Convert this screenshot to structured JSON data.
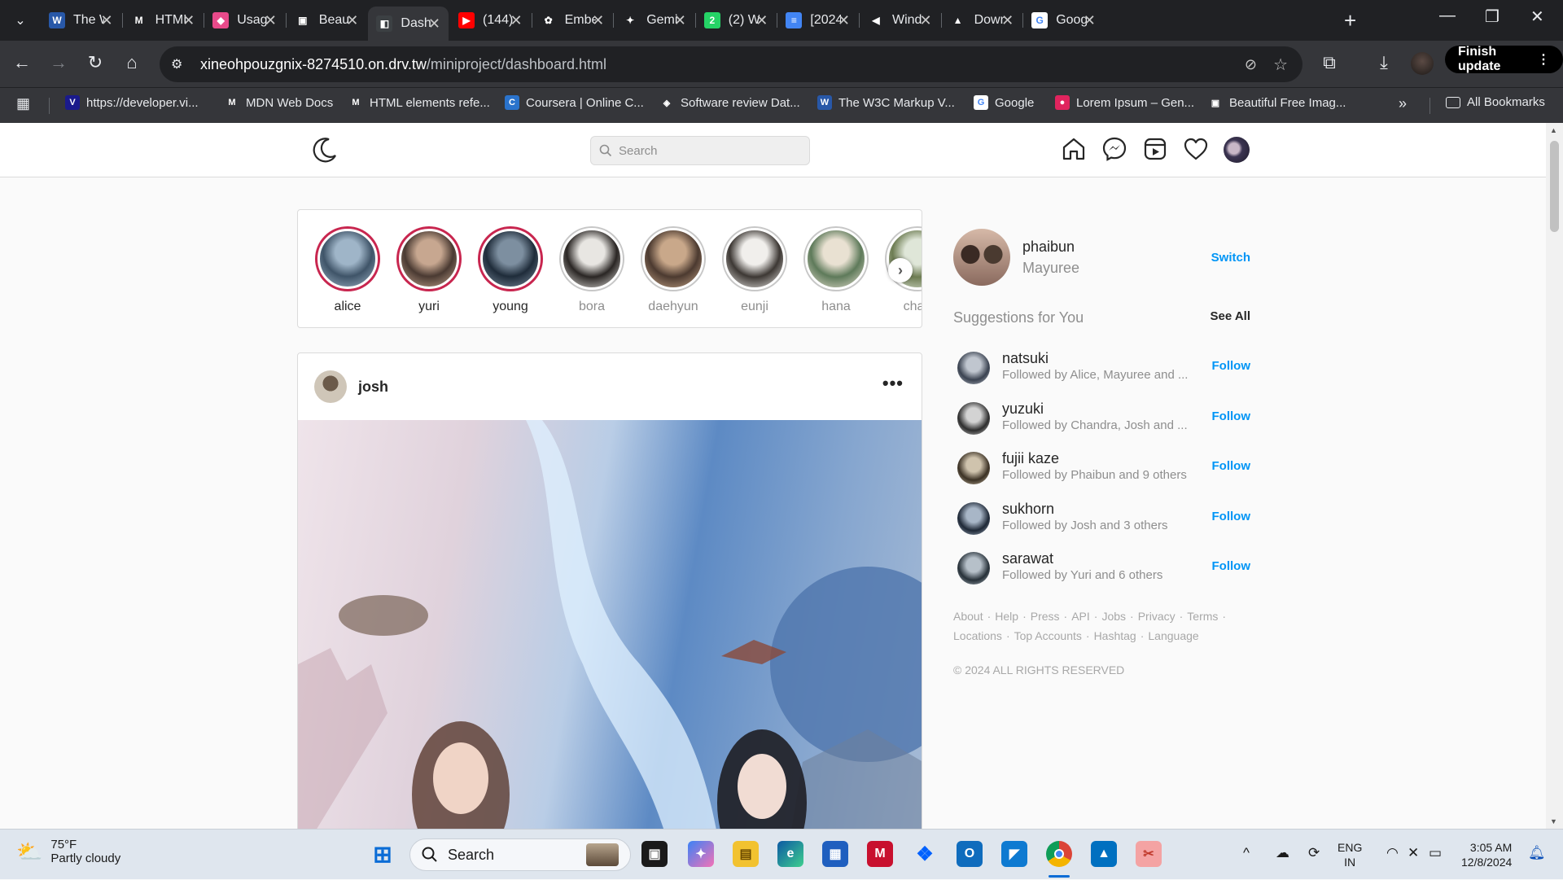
{
  "browser": {
    "tabs": [
      {
        "title": "The W",
        "icon": "w3c-icon",
        "color": "#2858a8",
        "glyph": "W"
      },
      {
        "title": "HTML",
        "icon": "mdn-icon",
        "color": "#202124",
        "glyph": "M"
      },
      {
        "title": "Usag",
        "icon": "cube-icon",
        "color": "#e84a8a",
        "glyph": "◆"
      },
      {
        "title": "Beau",
        "icon": "camera-icon",
        "color": "#202124",
        "glyph": "▣"
      },
      {
        "title": "Dash",
        "icon": "page-icon",
        "color": "#3c4043",
        "glyph": "◧"
      },
      {
        "title": "(144)",
        "icon": "youtube-icon",
        "color": "#ff0000",
        "glyph": "▶"
      },
      {
        "title": "Embe",
        "icon": "openai-icon",
        "color": "#202124",
        "glyph": "✿"
      },
      {
        "title": "Gemi",
        "icon": "gemini-icon",
        "color": "#202124",
        "glyph": "✦"
      },
      {
        "title": "(2) W",
        "icon": "whatsapp-icon",
        "color": "#25d366",
        "glyph": "2"
      },
      {
        "title": "[2024",
        "icon": "docs-icon",
        "color": "#4285f4",
        "glyph": "≡"
      },
      {
        "title": "Wind",
        "icon": "flutter-icon",
        "color": "#202124",
        "glyph": "◀"
      },
      {
        "title": "Down",
        "icon": "android-icon",
        "color": "#202124",
        "glyph": "▲"
      },
      {
        "title": "Goog",
        "icon": "google-icon",
        "color": "#ffffff",
        "glyph": "G"
      }
    ],
    "url_host": "xineohpouzgnix-8274510.on.drv.tw",
    "url_path": "/miniproject/dashboard.html",
    "finish_update": "Finish update",
    "bookmarks": [
      {
        "label": "https://developer.vi...",
        "icon": "vimeo-icon",
        "color": "#1a1a8c",
        "glyph": "V"
      },
      {
        "label": "MDN Web Docs",
        "icon": "mdn-icon",
        "color": "#35363a",
        "glyph": "M"
      },
      {
        "label": "HTML elements refe...",
        "icon": "mdn-icon",
        "color": "#35363a",
        "glyph": "M"
      },
      {
        "label": "Coursera | Online C...",
        "icon": "coursera-icon",
        "color": "#2a73cc",
        "glyph": "C"
      },
      {
        "label": "Software review Dat...",
        "icon": "g2-icon",
        "color": "#35363a",
        "glyph": "◈"
      },
      {
        "label": "The W3C Markup V...",
        "icon": "w3c-icon",
        "color": "#2858a8",
        "glyph": "W"
      },
      {
        "label": "Google",
        "icon": "google-icon",
        "color": "#ffffff",
        "glyph": "G"
      },
      {
        "label": "Lorem Ipsum – Gen...",
        "icon": "lorem-icon",
        "color": "#e0245e",
        "glyph": "●"
      },
      {
        "label": "Beautiful Free Imag...",
        "icon": "unsplash-icon",
        "color": "#35363a",
        "glyph": "▣"
      }
    ],
    "all_bookmarks": "All Bookmarks"
  },
  "app": {
    "search_placeholder": "Search",
    "stories": [
      {
        "name": "alice",
        "seen": false,
        "c1": "#9fb5c8",
        "c2": "#3f5468"
      },
      {
        "name": "yuri",
        "seen": false,
        "c1": "#c7a790",
        "c2": "#4a3a32"
      },
      {
        "name": "young",
        "seen": false,
        "c1": "#7d8fa0",
        "c2": "#1f2c3a"
      },
      {
        "name": "bora",
        "seen": true,
        "c1": "#e8e6e2",
        "c2": "#2a2624"
      },
      {
        "name": "daehyun",
        "seen": true,
        "c1": "#c9a88a",
        "c2": "#4c3a30"
      },
      {
        "name": "eunji",
        "seen": true,
        "c1": "#f1efec",
        "c2": "#3d3834"
      },
      {
        "name": "hana",
        "seen": true,
        "c1": "#e9e1d2",
        "c2": "#5e7a5a"
      },
      {
        "name": "chan",
        "seen": true,
        "c1": "#dfe6d8",
        "c2": "#6d7c52"
      }
    ],
    "post": {
      "user": "josh",
      "more": "•••"
    },
    "me": {
      "username": "phaibun",
      "name": "Mayuree",
      "switch": "Switch"
    },
    "suggestions_heading": "Suggestions for You",
    "see_all": "See All",
    "suggestions": [
      {
        "user": "natsuki",
        "followed": "Followed by Alice, Mayuree and ...",
        "follow": "Follow",
        "c1": "#c0c6cf",
        "c2": "#3a4250"
      },
      {
        "user": "yuzuki",
        "followed": "Followed by Chandra, Josh and ...",
        "follow": "Follow",
        "c1": "#d3d3d3",
        "c2": "#2d2d2d"
      },
      {
        "user": "fujii kaze",
        "followed": "Followed by Phaibun and 9 others",
        "follow": "Follow",
        "c1": "#cfc3ad",
        "c2": "#3b3124"
      },
      {
        "user": "sukhorn",
        "followed": "Followed by Josh and 3 others",
        "follow": "Follow",
        "c1": "#a8b6c7",
        "c2": "#1e2836"
      },
      {
        "user": "sarawat",
        "followed": "Followed by Yuri and 6 others",
        "follow": "Follow",
        "c1": "#b6c0c9",
        "c2": "#263038"
      }
    ],
    "footer_links_row1": [
      "About",
      "Help",
      "Press",
      "API",
      "Jobs",
      "Privacy",
      "Terms"
    ],
    "footer_links_row2": [
      "Locations",
      "Top Accounts",
      "Hashtag",
      "Language"
    ],
    "copyright": "© 2024 ALL RIGHTS RESERVED"
  },
  "taskbar": {
    "temp": "75°F",
    "condition": "Partly cloudy",
    "search": "Search",
    "lang1": "ENG",
    "lang2": "IN",
    "time": "3:05 AM",
    "date": "12/8/2024"
  }
}
